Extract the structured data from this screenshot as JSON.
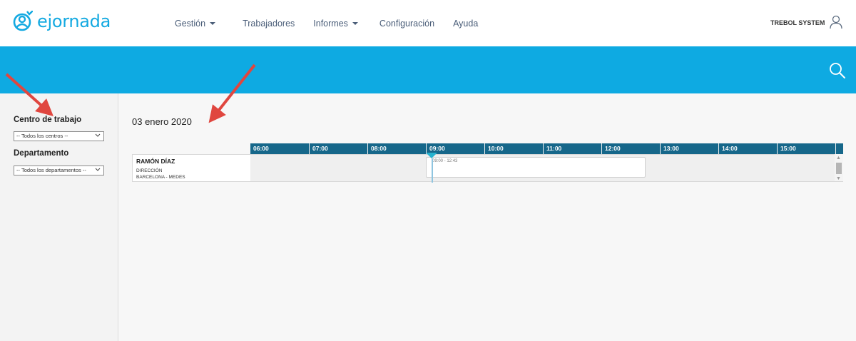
{
  "brand": {
    "name": "ejornada",
    "color": "#13a9e1"
  },
  "nav": {
    "items": [
      {
        "label": "Gestión",
        "dropdown": true
      },
      {
        "label": "Trabajadores",
        "dropdown": false
      },
      {
        "label": "Informes",
        "dropdown": true
      },
      {
        "label": "Configuración",
        "dropdown": false
      },
      {
        "label": "Ayuda",
        "dropdown": false
      }
    ]
  },
  "header": {
    "company": "TREBOL SYSTEM",
    "user_icon": "user-icon"
  },
  "band": {
    "color": "#0eaae2",
    "search_icon": "search-icon"
  },
  "sidebar": {
    "work_center_label": "Centro de trabajo",
    "work_center_value": "-- Todos los centros --",
    "department_label": "Departamento",
    "department_value": "-- Todos los departamentos --"
  },
  "main": {
    "date": "03 enero 2020",
    "hours": [
      "06:00",
      "07:00",
      "08:00",
      "09:00",
      "10:00",
      "11:00",
      "12:00",
      "13:00",
      "14:00",
      "15:00"
    ],
    "header_color": "#16678a",
    "employee": {
      "name": "RAMÓN DÍAZ",
      "department": "DIRECCIÓN",
      "center": "BARCELONA - MEDES"
    },
    "shift": {
      "label": "09:00 - 12:43",
      "start": "09:00",
      "end": "12:43"
    }
  },
  "annotation_color": "#e0463f"
}
